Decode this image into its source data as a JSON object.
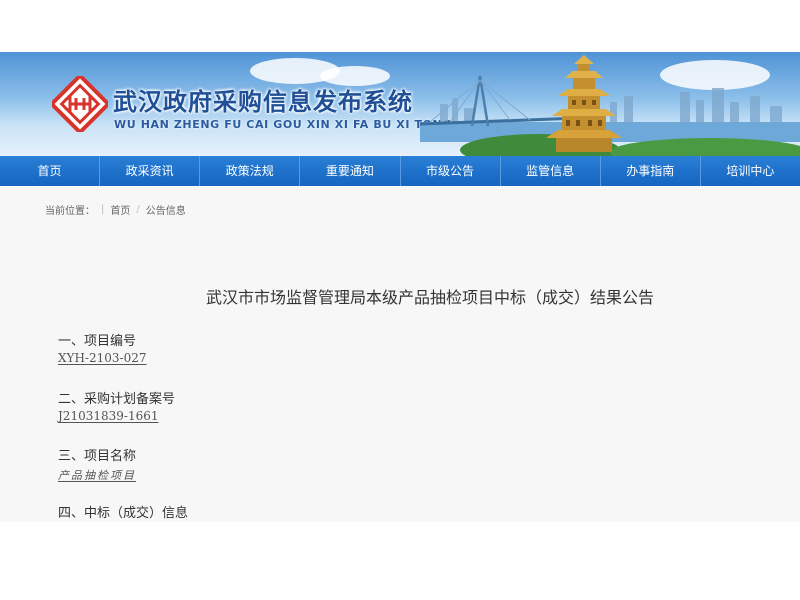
{
  "header": {
    "title": "武汉政府采购信息发布系统",
    "subtitle": "WU HAN ZHENG FU CAI GOU XIN XI FA BU XI TONG"
  },
  "nav": {
    "items": [
      "首页",
      "政采资讯",
      "政策法规",
      "重要通知",
      "市级公告",
      "监管信息",
      "办事指南",
      "培训中心"
    ]
  },
  "breadcrumb": {
    "label": "当前位置：",
    "items": [
      "首页",
      "公告信息"
    ]
  },
  "article": {
    "title": "武汉市市场监督管理局本级产品抽检项目中标（成交）结果公告",
    "sections": [
      {
        "heading": "一、项目编号",
        "value": "XYH-2103-027"
      },
      {
        "heading": "二、采购计划备案号",
        "value": "J21031839-1661"
      },
      {
        "heading": "三、项目名称",
        "value": "产品抽检项目"
      },
      {
        "heading": "四、中标（成交）信息",
        "value": ""
      }
    ]
  },
  "colors": {
    "nav_bg": "#1565c0",
    "title_blue": "#1f4f96",
    "logo_red": "#d9342b"
  }
}
